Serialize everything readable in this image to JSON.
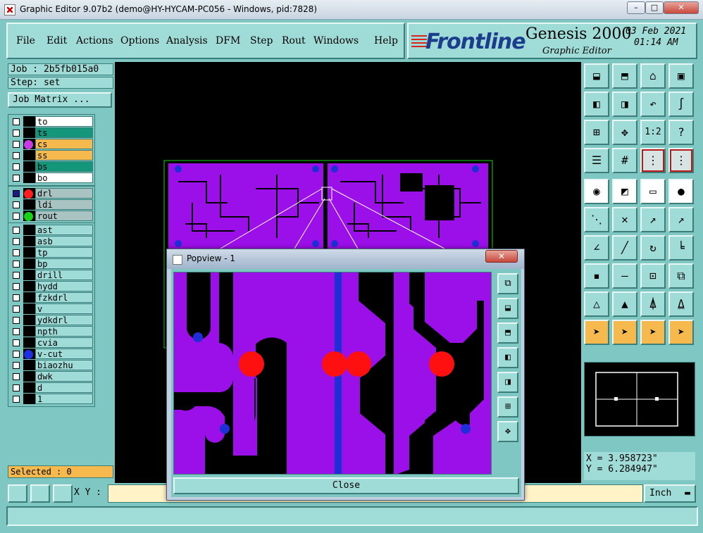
{
  "window": {
    "title": "Graphic Editor 9.07b2 (demo@HY-HYCAM-PC056 - Windows, pid:7828)",
    "minimize": "–",
    "maximize": "□",
    "close": "✕"
  },
  "menu": {
    "items": [
      "File",
      "Edit",
      "Actions",
      "Options",
      "Analysis",
      "DFM",
      "Step",
      "Rout",
      "Windows",
      "Help"
    ]
  },
  "brand": {
    "logo": "Frontline",
    "product": "Genesis 2000",
    "subtitle": "Graphic Editor",
    "date": "03 Feb 2021",
    "time": "01:14 AM"
  },
  "job": {
    "job_label": "Job : 2b5fb015a0",
    "step_label": "Step: set",
    "matrix_button": "Job Matrix ..."
  },
  "layers": {
    "group1": [
      {
        "name": "to",
        "bg": "#ffffff",
        "dot": ""
      },
      {
        "name": "ts",
        "bg": "#13967a",
        "dot": ""
      },
      {
        "name": "cs",
        "bg": "#f5b94e",
        "dot": "#c83be0"
      },
      {
        "name": "ss",
        "bg": "#f5b94e",
        "dot": ""
      },
      {
        "name": "bs",
        "bg": "#13967a",
        "dot": ""
      },
      {
        "name": "bo",
        "bg": "#ffffff",
        "dot": ""
      }
    ],
    "group2": [
      {
        "name": "drl",
        "bg": "#a9c2c2",
        "dot": "#ff1d1d",
        "active": true
      },
      {
        "name": "ldi",
        "bg": "#a9c2c2",
        "dot": ""
      },
      {
        "name": "rout",
        "bg": "#a9c2c2",
        "dot": "#17d317"
      }
    ],
    "group3": [
      {
        "name": "ast",
        "bg": "#a0dcd7",
        "dot": ""
      },
      {
        "name": "asb",
        "bg": "#a0dcd7",
        "dot": ""
      },
      {
        "name": "tp",
        "bg": "#a0dcd7",
        "dot": ""
      },
      {
        "name": "bp",
        "bg": "#a0dcd7",
        "dot": ""
      },
      {
        "name": "drill",
        "bg": "#a0dcd7",
        "dot": ""
      },
      {
        "name": "hydd",
        "bg": "#a0dcd7",
        "dot": ""
      },
      {
        "name": "fzkdrl",
        "bg": "#a0dcd7",
        "dot": ""
      },
      {
        "name": "v",
        "bg": "#a0dcd7",
        "dot": ""
      },
      {
        "name": "ydkdrl",
        "bg": "#a0dcd7",
        "dot": ""
      },
      {
        "name": "npth",
        "bg": "#a0dcd7",
        "dot": ""
      },
      {
        "name": "cvia",
        "bg": "#a0dcd7",
        "dot": ""
      },
      {
        "name": "v-cut",
        "bg": "#a0dcd7",
        "dot": "#1e2fe0"
      },
      {
        "name": "biaozhu",
        "bg": "#a0dcd7",
        "dot": ""
      },
      {
        "name": "dwk",
        "bg": "#a0dcd7",
        "dot": ""
      },
      {
        "name": "d",
        "bg": "#a0dcd7",
        "dot": ""
      },
      {
        "name": "1",
        "bg": "#a0dcd7",
        "dot": ""
      }
    ]
  },
  "selected": "Selected : 0",
  "coords": {
    "x": "X = 3.958723\"",
    "y": "Y = 6.284947\""
  },
  "toolbar": {
    "scale_button": "1:2",
    "help_button": "?"
  },
  "bottom": {
    "xy_label": "X Y :",
    "xy_value": "",
    "unit": "Inch"
  },
  "popview": {
    "title": "Popview - 1",
    "close_x": "✕",
    "close_button": "Close"
  },
  "colors": {
    "panel": "#7fc7c3",
    "button": "#a0dcd7",
    "copper": "#9b0fe8",
    "drill": "#ff1010",
    "vcut": "#1e2fd8",
    "highlight": "#f5b94e"
  }
}
